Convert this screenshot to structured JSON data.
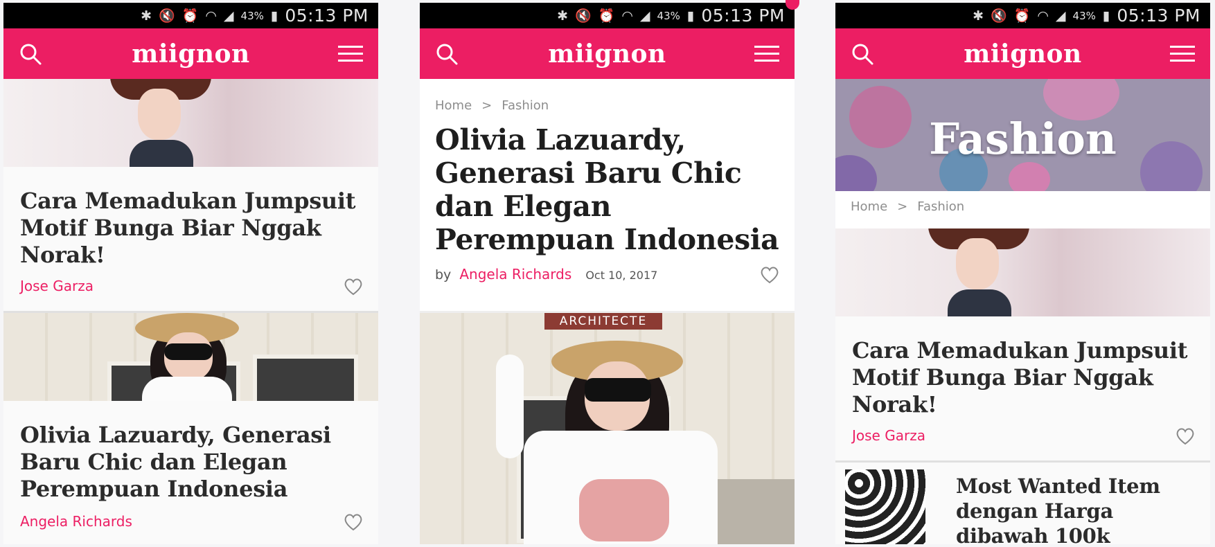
{
  "status_bar": {
    "battery": "43%",
    "time": "05:13 PM"
  },
  "app": {
    "logo": "miignon",
    "accent": "#ec1e63"
  },
  "screen1": {
    "cards": [
      {
        "title": "Cara Memadukan Jumpsuit Motif Bunga Biar Nggak Norak!",
        "author": "Jose Garza"
      },
      {
        "title": "Olivia Lazuardy, Generasi Baru Chic dan Elegan Perempuan Indonesia",
        "author": "Angela Richards"
      }
    ]
  },
  "screen2": {
    "breadcrumb": {
      "home": "Home",
      "sep": ">",
      "current": "Fashion"
    },
    "title": "Olivia Lazuardy, Generasi Baru Chic dan Elegan Perempuan Indonesia",
    "by": "by",
    "author": "Angela Richards",
    "date": "Oct 10, 2017",
    "building_sign": "ARCHITECTE"
  },
  "screen3": {
    "banner_title": "Fashion",
    "breadcrumb": {
      "home": "Home",
      "sep": ">",
      "current": "Fashion"
    },
    "card": {
      "title": "Cara Memadukan Jumpsuit Motif Bunga Biar Nggak Norak!",
      "author": "Jose Garza"
    },
    "next_item": {
      "title": "Most Wanted Item dengan Harga dibawah 100k"
    }
  }
}
